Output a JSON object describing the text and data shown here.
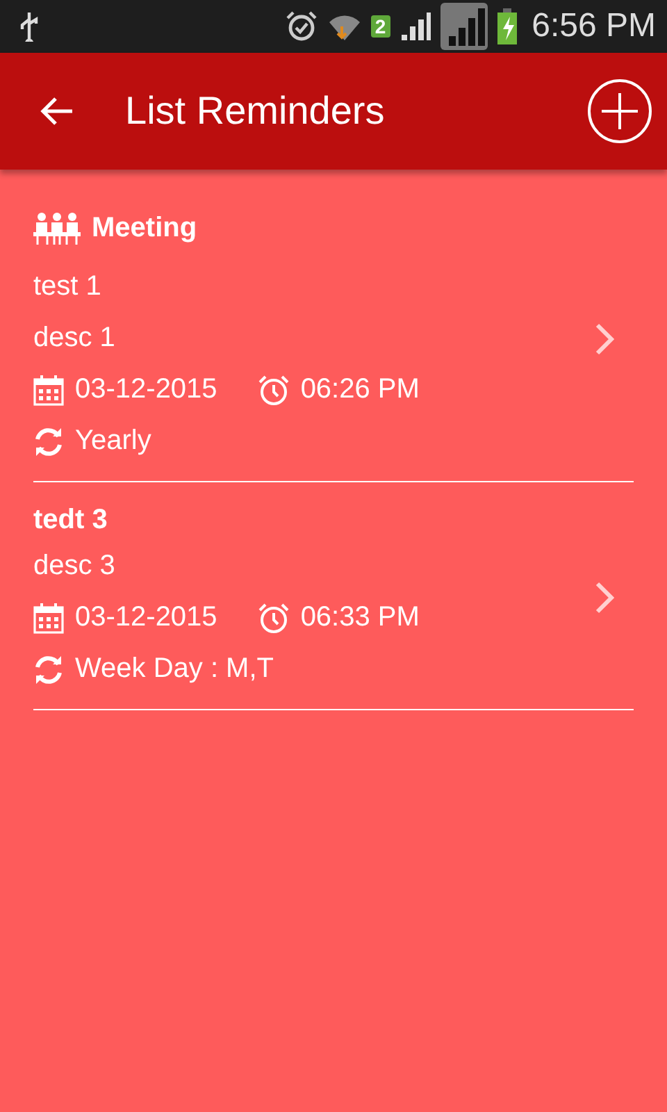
{
  "status_bar": {
    "time": "6:56 PM",
    "sim_badge": "2"
  },
  "app_bar": {
    "title": "List Reminders"
  },
  "reminders": [
    {
      "kind": "meeting",
      "title": "Meeting",
      "lines": [
        "test 1",
        "desc 1"
      ],
      "date": "03-12-2015",
      "time": "06:26 PM",
      "repeat": "Yearly"
    },
    {
      "kind": "plain",
      "title": "tedt 3",
      "lines": [
        "desc 3"
      ],
      "date": "03-12-2015",
      "time": "06:33 PM",
      "repeat": "Week Day : M,T"
    }
  ]
}
